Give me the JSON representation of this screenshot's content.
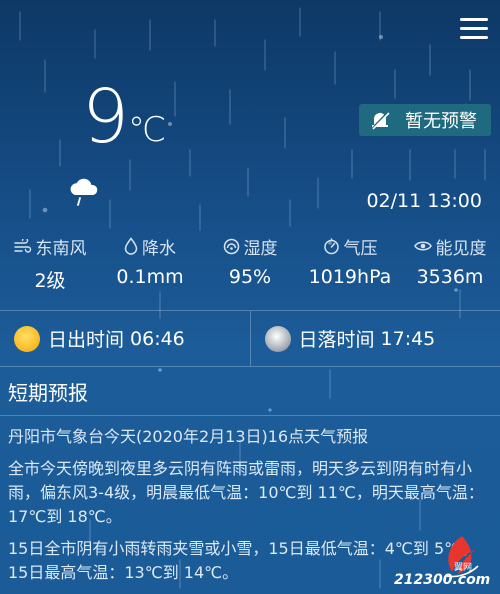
{
  "current": {
    "temperature": "9",
    "unit": "℃",
    "condition_icon": "cloud-rain-icon",
    "datetime": "02/11 13:00"
  },
  "alert": {
    "label": "暂无预警",
    "icon": "bell-off-icon"
  },
  "stats": [
    {
      "icon": "wind-icon",
      "label": "东南风",
      "value": "2级"
    },
    {
      "icon": "drop-icon",
      "label": "降水",
      "value": "0.1mm"
    },
    {
      "icon": "humidity-icon",
      "label": "湿度",
      "value": "95%"
    },
    {
      "icon": "pressure-icon",
      "label": "气压",
      "value": "1019hPa"
    },
    {
      "icon": "eye-icon",
      "label": "能见度",
      "value": "3536m"
    }
  ],
  "sun": {
    "sunrise_label": "日出时间",
    "sunrise_time": "06:46",
    "sunset_label": "日落时间",
    "sunset_time": "17:45"
  },
  "forecast": {
    "title": "短期预报",
    "lines": [
      "丹阳市气象台今天(2020年2月13日)16点天气预报",
      "全市今天傍晚到夜里多云阴有阵雨或雷雨，明天多云到阴有时有小雨，偏东风3-4级，明晨最低气温：10℃到 11℃，明天最高气温：17℃到 18℃。",
      "15日全市阴有小雨转雨夹雪或小雪，15日最低气温：4℃到 5℃，15日最高气温：13℃到 14℃。"
    ]
  },
  "watermark": {
    "text": "212300.com",
    "sub": "翼网"
  }
}
